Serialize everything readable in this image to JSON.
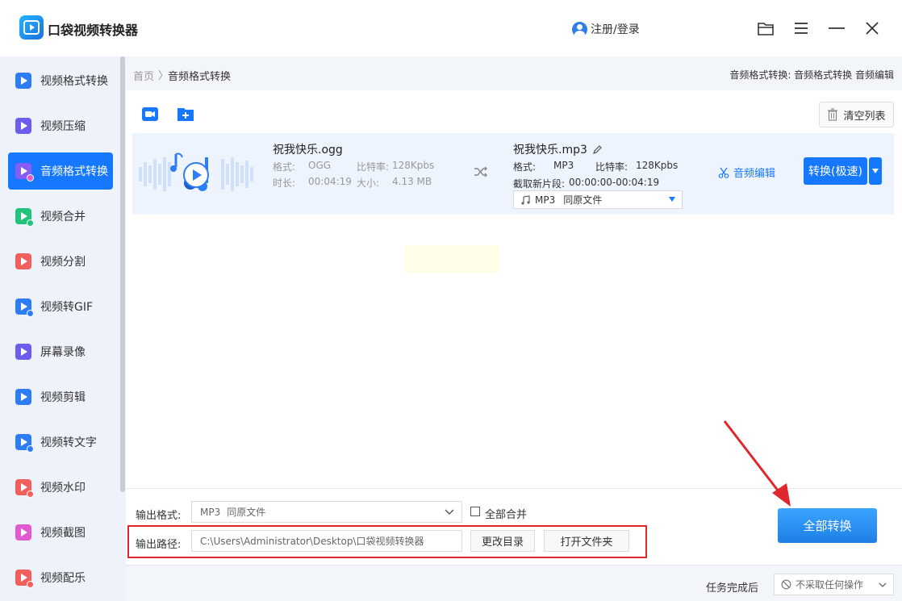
{
  "app": {
    "title": "口袋视频转换器",
    "login_label": "注册/登录"
  },
  "sidebar": {
    "items": [
      {
        "label": "视频格式转换",
        "color": "#2f7df6",
        "active": false
      },
      {
        "label": "视频压缩",
        "color": "#6d5cf0",
        "active": false
      },
      {
        "label": "音频格式转换",
        "color": "#8a5cf6",
        "active": true
      },
      {
        "label": "视频合并",
        "color": "#22c37a",
        "active": false
      },
      {
        "label": "视频分割",
        "color": "#f25f5c",
        "active": false
      },
      {
        "label": "视频转GIF",
        "color": "#2f7df6",
        "active": false
      },
      {
        "label": "屏幕录像",
        "color": "#6d5cf0",
        "active": false
      },
      {
        "label": "视频剪辑",
        "color": "#2f7df6",
        "active": false
      },
      {
        "label": "视频转文字",
        "color": "#2f7df6",
        "active": false
      },
      {
        "label": "视频水印",
        "color": "#f25f5c",
        "active": false
      },
      {
        "label": "视频截图",
        "color": "#e35bd0",
        "active": false
      },
      {
        "label": "视频配乐",
        "color": "#f25f5c",
        "active": false
      }
    ]
  },
  "breadcrumb": {
    "home": "首页",
    "sep": "〉",
    "current": "音频格式转换",
    "right": "音频格式转换: 音频格式转换 音频编辑"
  },
  "toolbar": {
    "clear_label": "清空列表"
  },
  "file": {
    "source_name": "祝我快乐.ogg",
    "format_label": "格式:",
    "format_value": "OGG",
    "bitrate_label": "比特率:",
    "bitrate_value": "128Kpbs",
    "duration_label": "时长:",
    "duration_value": "00:04:19",
    "size_label": "大小:",
    "size_value": "4.13 MB",
    "output_name": "祝我快乐.mp3",
    "out_format_label": "格式:",
    "out_format_value": "MP3",
    "out_bitrate_label": "比特率:",
    "out_bitrate_value": "128Kpbs",
    "clip_label": "截取新片段:",
    "clip_value": "00:00:00-00:04:19",
    "select_format": "MP3",
    "select_quality": "同原文件",
    "audio_edit_label": "音频编辑",
    "convert_label": "转换(极速)"
  },
  "bottom": {
    "output_format_label": "输出格式:",
    "output_format_value": "MP3",
    "output_format_quality": "同原文件",
    "merge_label": "全部合并",
    "output_path_label": "输出路径:",
    "output_path_value": "C:\\Users\\Administrator\\Desktop\\口袋视频转换器",
    "change_dir_label": "更改目录",
    "open_folder_label": "打开文件夹",
    "convert_all_label": "全部转换"
  },
  "status": {
    "after_label": "任务完成后",
    "after_value": "不采取任何操作"
  },
  "colors": {
    "accent": "#1677ff",
    "highlight_box": "#e0262e",
    "annotation_arrow": "#e0262e"
  }
}
